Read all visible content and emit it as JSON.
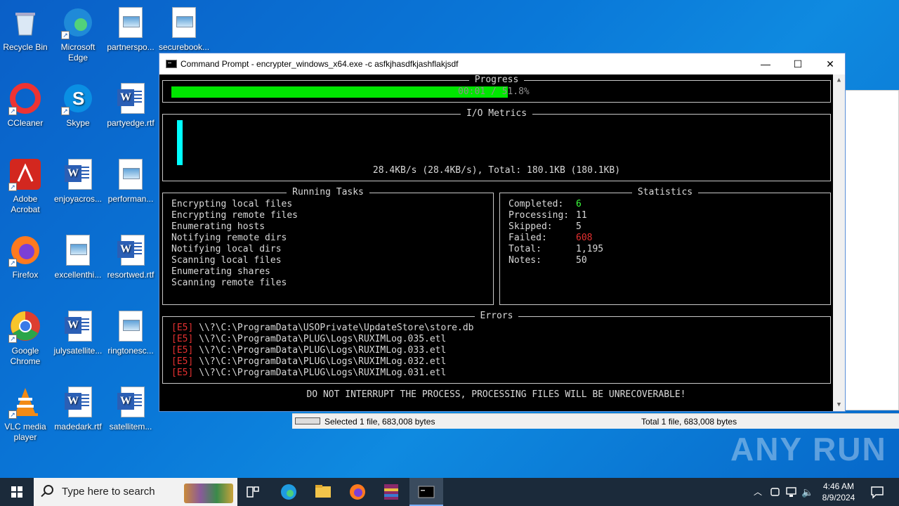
{
  "desktop": {
    "icons": [
      {
        "label": "Recycle Bin",
        "icon": "recycle-bin-icon"
      },
      {
        "label": "Microsoft Edge",
        "icon": "edge-icon"
      },
      {
        "label": "partnerspo...",
        "icon": "image-file-icon"
      },
      {
        "label": "securebook...",
        "icon": "image-file-icon"
      },
      {
        "label": "CCleaner",
        "icon": "ccleaner-icon"
      },
      {
        "label": "Skype",
        "icon": "skype-icon"
      },
      {
        "label": "partyedge.rtf",
        "icon": "word-file-icon"
      },
      {
        "label": "Adobe Acrobat",
        "icon": "acrobat-icon"
      },
      {
        "label": "enjoyacros...",
        "icon": "word-file-icon"
      },
      {
        "label": "performan...",
        "icon": "image-file-icon"
      },
      {
        "label": "Firefox",
        "icon": "firefox-icon"
      },
      {
        "label": "excellenthi...",
        "icon": "image-file-icon"
      },
      {
        "label": "resortwed.rtf",
        "icon": "word-file-icon"
      },
      {
        "label": "Google Chrome",
        "icon": "chrome-icon"
      },
      {
        "label": "julysatellite...",
        "icon": "word-file-icon"
      },
      {
        "label": "ringtonesc...",
        "icon": "image-file-icon"
      },
      {
        "label": "VLC media player",
        "icon": "vlc-icon"
      },
      {
        "label": "madedark.rtf",
        "icon": "word-file-icon"
      },
      {
        "label": "satellitem...",
        "icon": "word-file-icon"
      }
    ]
  },
  "console": {
    "title": "Command Prompt - encrypter_windows_x64.exe  -c asfkjhasdfkjashflakjsdf",
    "buttons": {
      "minimize": "—",
      "maximize": "☐",
      "close": "✕"
    },
    "progress": {
      "title": "Progress",
      "fraction": 0.518,
      "text": "00:01 / 51.8%"
    },
    "io": {
      "title": "I/O Metrics",
      "summary": "28.4KB/s (28.4KB/s), Total: 180.1KB (180.1KB)"
    },
    "tasks": {
      "title": "Running Tasks",
      "items": [
        "Encrypting local files",
        "Encrypting remote files",
        "Enumerating hosts",
        "Notifying remote dirs",
        "Notifying local dirs",
        "Scanning local files",
        "Enumerating shares",
        "Scanning remote files"
      ]
    },
    "stats": {
      "title": "Statistics",
      "rows": [
        {
          "label": "Completed:",
          "value": "6"
        },
        {
          "label": "Processing:",
          "value": "11"
        },
        {
          "label": "Skipped:",
          "value": "5"
        },
        {
          "label": "Failed:",
          "value": "608"
        },
        {
          "label": "Total:",
          "value": "1,195"
        },
        {
          "label": "Notes:",
          "value": "50"
        }
      ]
    },
    "errors": {
      "title": "Errors",
      "items": [
        {
          "code": "[E5]",
          "path": "\\\\?\\C:\\ProgramData\\USOPrivate\\UpdateStore\\store.db"
        },
        {
          "code": "[E5]",
          "path": "\\\\?\\C:\\ProgramData\\PLUG\\Logs\\RUXIMLog.035.etl"
        },
        {
          "code": "[E5]",
          "path": "\\\\?\\C:\\ProgramData\\PLUG\\Logs\\RUXIMLog.033.etl"
        },
        {
          "code": "[E5]",
          "path": "\\\\?\\C:\\ProgramData\\PLUG\\Logs\\RUXIMLog.032.etl"
        },
        {
          "code": "[E5]",
          "path": "\\\\?\\C:\\ProgramData\\PLUG\\Logs\\RUXIMLog.031.etl"
        }
      ]
    },
    "warning": "DO NOT INTERRUPT THE PROCESS, PROCESSING FILES WILL BE UNRECOVERABLE!"
  },
  "explorer_status": {
    "selected": "Selected 1 file, 683,008 bytes",
    "total": "Total 1 file, 683,008 bytes"
  },
  "watermark": "ANY RUN",
  "taskbar": {
    "search_placeholder": "Type here to search",
    "time": "4:46 AM",
    "date": "8/9/2024"
  },
  "colors": {
    "progress_fill": "#00e600",
    "io_bar": "#00ffff",
    "completed": "#3cff3c",
    "failed": "#e53030"
  }
}
